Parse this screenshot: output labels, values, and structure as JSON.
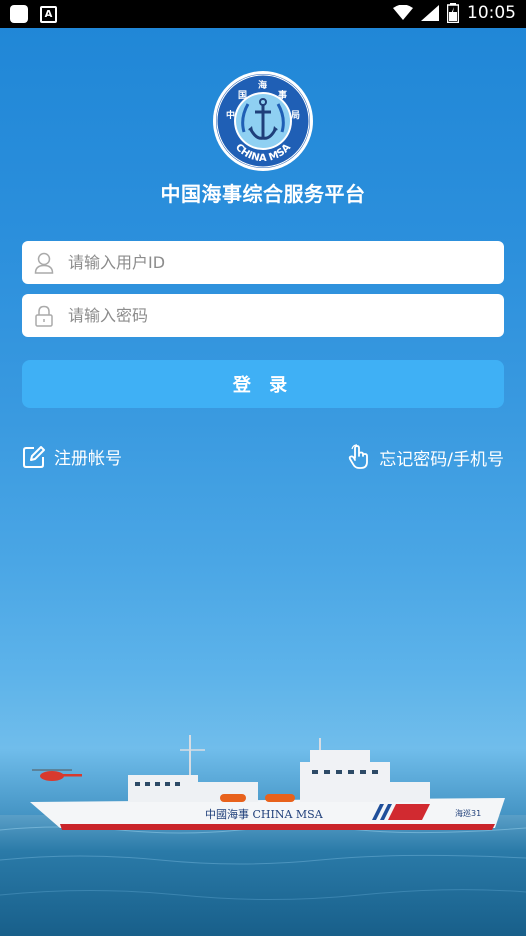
{
  "status_bar": {
    "time": "10:05",
    "a_badge": "A",
    "icons": [
      "app-square-icon",
      "a-notification-icon",
      "wifi-icon",
      "signal-icon",
      "battery-icon"
    ]
  },
  "logo": {
    "chars": [
      "中",
      "国",
      "海",
      "事",
      "局"
    ],
    "text_bottom": "CHINA MSA"
  },
  "app_title": "中国海事综合服务平台",
  "user_field": {
    "placeholder": "请输入用户ID",
    "value": ""
  },
  "password_field": {
    "placeholder": "请输入密码",
    "value": ""
  },
  "login_button": "登 录",
  "register_link": "注册帐号",
  "forgot_link": "忘记密码/手机号",
  "ship": {
    "hull_text": "中國海事 CHINA MSA",
    "name_text": "海巡31"
  },
  "colors": {
    "button": "#3fb0f5",
    "sky_top": "#1f86d6",
    "sea": "#1e6e9a"
  }
}
